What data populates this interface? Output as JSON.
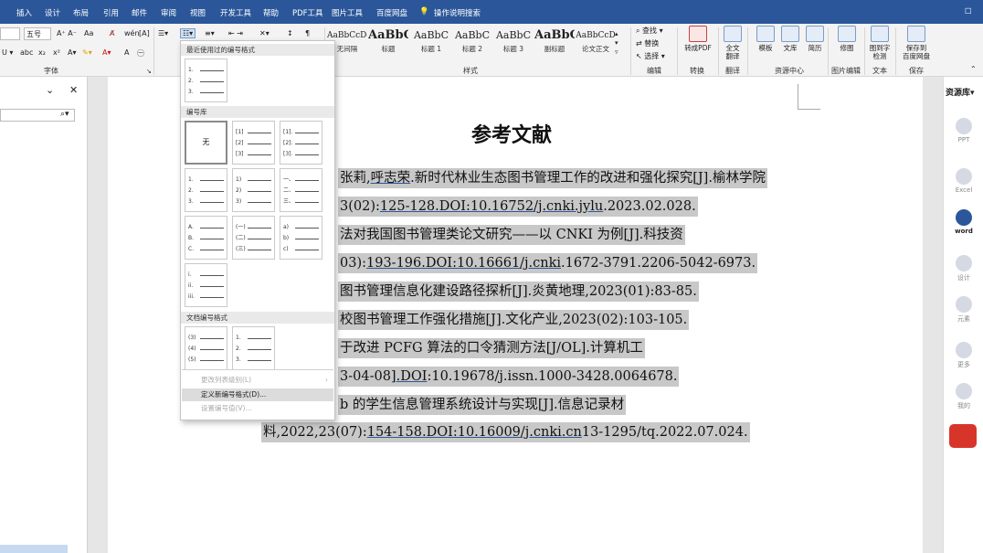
{
  "tabs": [
    "插入",
    "设计",
    "布局",
    "引用",
    "邮件",
    "审阅",
    "视图",
    "开发工具",
    "帮助",
    "PDF工具",
    "图片工具",
    "百度网盘",
    "操作说明搜索"
  ],
  "ribbon": {
    "font_size": "五号",
    "group_font": "字体",
    "group_styles": "样式",
    "styles": [
      {
        "sample": "AaBbCcDc",
        "name": "无间隔"
      },
      {
        "sample": "AaBbC",
        "name": "标题"
      },
      {
        "sample": "AaBbC",
        "name": "标题 1"
      },
      {
        "sample": "AaBbC",
        "name": "标题 2"
      },
      {
        "sample": "AaBbC",
        "name": "标题 3"
      },
      {
        "sample": "AaBbC",
        "name": "副标题"
      },
      {
        "sample": "AaBbCcD",
        "name": "论文正文"
      }
    ],
    "edit": {
      "find": "查找",
      "replace": "替换",
      "select": "选择",
      "label": "编辑"
    },
    "convert": {
      "btn": "转成PDF",
      "label": "转换"
    },
    "translate": {
      "btn1": "全文",
      "btn2": "翻译",
      "label": "翻译"
    },
    "resource": {
      "template": "模板",
      "library": "文库",
      "resume": "简历",
      "label": "资源中心"
    },
    "picture": {
      "btn": "修图",
      "label": "图片编辑"
    },
    "text": {
      "btn1": "图到字",
      "btn2": "检测",
      "label": "文本"
    },
    "save": {
      "btn1": "保存到",
      "btn2": "百度网盘",
      "label": "保存"
    }
  },
  "dropdown": {
    "recent_header": "最近使用过的编号格式",
    "library_header": "编号库",
    "none_label": "无",
    "doc_header": "文档编号格式",
    "cards": [
      [
        "1.",
        "2.",
        "3."
      ],
      [
        "[1]",
        "[2]",
        "[3]"
      ],
      [
        "[1].",
        "[2].",
        "[3]."
      ],
      [
        "1.",
        "2.",
        "3."
      ],
      [
        "1)",
        "2)",
        "3)"
      ],
      [
        "一、",
        "二、",
        "三、"
      ],
      [
        "A.",
        "B.",
        "C."
      ],
      [
        "(一)",
        "(二)",
        "(三)"
      ],
      [
        "a)",
        "b)",
        "c)"
      ],
      [
        "i.",
        "ii.",
        "iii."
      ]
    ],
    "doc_cards": [
      [
        "(3)",
        "(4)",
        "(5)"
      ],
      [
        "1.",
        "2.",
        "3."
      ]
    ],
    "menu": [
      "更改列表级别(L)",
      "定义新编号格式(D)...",
      "设置编号值(V)..."
    ]
  },
  "document": {
    "title": "参考文献",
    "lines": [
      {
        "segs": [
          {
            "t": "张莉,",
            "u": false
          },
          {
            "t": "呼志荣",
            "u": true
          },
          {
            "t": ".新时代林业生态图书管理工作的改进和强化探究[J].榆林学院",
            "u": false
          }
        ]
      },
      {
        "segs": [
          {
            "t": "3(02):",
            "u": false
          },
          {
            "t": "125-128.DOI:10.16752/j.cnki.jylu",
            "u": true
          },
          {
            "t": ".2023.02.028.",
            "u": false
          }
        ]
      },
      {
        "segs": [
          {
            "t": "法对我国图书管理类论文研究——以 CNKI 为例[J].科技资",
            "u": false
          }
        ]
      },
      {
        "segs": [
          {
            "t": "03):",
            "u": false
          },
          {
            "t": "193-196.DOI:10.16661/j.cnki",
            "u": true
          },
          {
            "t": ".1672-3791.2206-5042-6973.",
            "u": false
          }
        ]
      },
      {
        "segs": [
          {
            "t": "图书管理信息化建设路径探析[J].炎黄地理,2023(01):83-85.",
            "u": false
          }
        ]
      },
      {
        "segs": [
          {
            "t": "校图书管理工作强化措施[J].文化产业,2023(02):103-105.",
            "u": false
          }
        ]
      },
      {
        "segs": [
          {
            "t": "于改进 PCFG 算法的口令猜测方法[J/OL].计算机工",
            "u": false
          }
        ]
      },
      {
        "segs": [
          {
            "t": "3-04-08]",
            "u": false
          },
          {
            "t": ".DOI",
            "u": true
          },
          {
            "t": ":10.19678/j.issn.1000-3428.0064678.",
            "u": false
          }
        ]
      },
      {
        "segs": [
          {
            "t": "b 的学生信息管理系统设计与实现[J].信息记录材",
            "u": false
          }
        ]
      },
      {
        "segs": [
          {
            "t": "料,2022,23(07):",
            "u": false
          },
          {
            "t": "154-158.DOI:10.16009/j.cnki.cn",
            "u": true
          },
          {
            "t": "13-1295/tq.2022.07.024.",
            "u": false
          }
        ]
      }
    ]
  },
  "right_panel": {
    "title": "资源库",
    "items": [
      "PPT",
      "Excel",
      "word",
      "设计",
      "元素",
      "更多",
      "我的"
    ]
  }
}
